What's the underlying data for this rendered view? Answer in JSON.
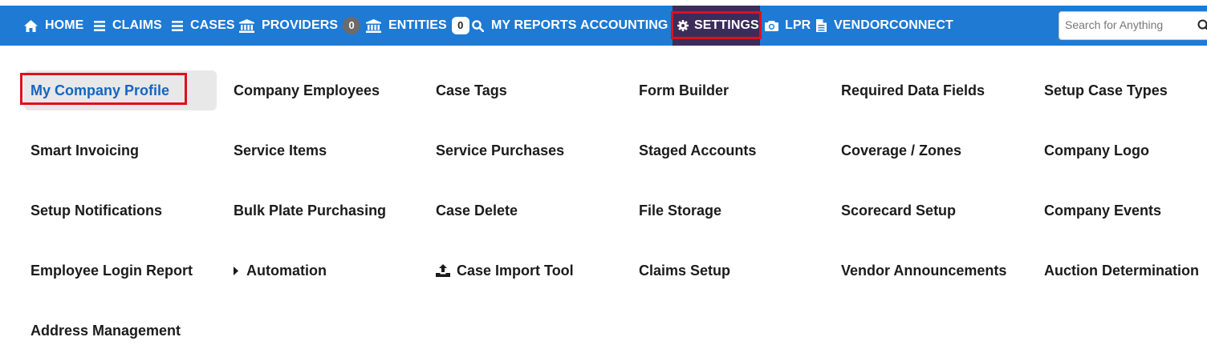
{
  "nav": {
    "items": [
      {
        "label": "HOME",
        "icon": "home-icon"
      },
      {
        "label": "CLAIMS",
        "icon": "list-icon"
      },
      {
        "label": "CASES",
        "icon": "list-icon"
      },
      {
        "label": "PROVIDERS",
        "icon": "bank-icon",
        "badge": "0"
      },
      {
        "label": "ENTITIES",
        "icon": "bank-icon",
        "badge": "0"
      },
      {
        "label": "MY REPORTS",
        "icon": "search-icon"
      },
      {
        "label": "ACCOUNTING"
      },
      {
        "label": "SETTINGS",
        "icon": "gear-icon"
      },
      {
        "label": "LPR",
        "icon": "camera-icon"
      },
      {
        "label": "VENDORCONNECT",
        "icon": "document-icon"
      }
    ],
    "search_placeholder": "Search for Anything"
  },
  "settings_menu": {
    "items": [
      "My Company Profile",
      "Company Employees",
      "Case Tags",
      "Form Builder",
      "Required Data Fields",
      "Setup Case Types",
      "Smart Invoicing",
      "Service Items",
      "Service Purchases",
      "Staged Accounts",
      "Coverage / Zones",
      "Company Logo",
      "Setup Notifications",
      "Bulk Plate Purchasing",
      "Case Delete",
      "File Storage",
      "Scorecard Setup",
      "Company Events",
      "Employee Login Report",
      "Automation",
      "Case Import Tool",
      "Claims Setup",
      "Vendor Announcements",
      "Auction Determination",
      "Address Management"
    ]
  },
  "colors": {
    "navbar": "#1f7ad4",
    "active_nav": "#3c2c5a",
    "highlight": "#e0101a",
    "active_link": "#1565c0"
  }
}
